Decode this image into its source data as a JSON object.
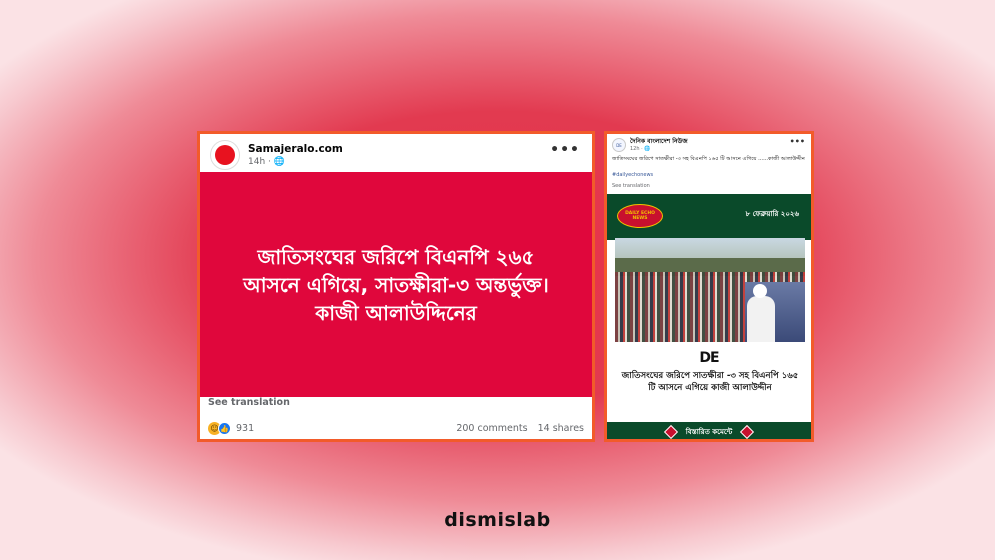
{
  "left_post": {
    "page_name": "Samajeralo.com",
    "time": "14h · 🌐",
    "more": "•••",
    "headline": "জাতিসংঘের জরিপে বিএনপি ২৬৫ আসনে এগিয়ে, সাতক্ষীরা-৩ অন্তর্ভুক্ত। কাজী আলাউদ্দিনের",
    "see_translation": "See translation",
    "reactions_count": "931",
    "comments": "200 comments",
    "shares": "14 shares",
    "colors": {
      "panel": "#e0073c",
      "border": "#f25b2a"
    }
  },
  "right_post": {
    "page_name": "দৈনিক বাংলাদেশ নিউজ",
    "time": "12h · 🌐",
    "more": "•••",
    "caption": "জাতিসংঘের জরিপে সাতক্ষীরা -৩ সহ বিএনপি ১৬৫ টি আসনে এগিয়ে ......কাজী আলাউদ্দীন",
    "hashtag": "#dailyechonews",
    "see_translation": "See translation",
    "logo_text": "DAILY ECHO NEWS",
    "date": "৮ ফেব্রুয়ারি ২০২৬",
    "de_mark": "DE",
    "headline": "জাতিসংঘের জরিপে সাতক্ষীরা -৩ সহ বিএনপি ১৬৫ টি আসনে এগিয়ে কাজী আলাউদ্দীন",
    "bottom_label": "বিস্তারিত কমেন্টে",
    "colors": {
      "band": "#0a4a2a",
      "accent": "#c8102e"
    }
  },
  "brand": "dismislab"
}
